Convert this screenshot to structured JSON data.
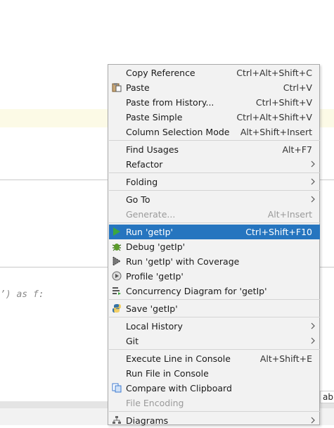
{
  "editor": {
    "code_fragment": "’) as f:",
    "right_fragment": "abl"
  },
  "menu": {
    "items": [
      {
        "id": "copy-reference",
        "label": "Copy Reference",
        "shortcut": "Ctrl+Alt+Shift+C"
      },
      {
        "id": "paste",
        "label": "Paste",
        "shortcut": "Ctrl+V"
      },
      {
        "id": "paste-from-history",
        "label": "Paste from History...",
        "shortcut": "Ctrl+Shift+V"
      },
      {
        "id": "paste-simple",
        "label": "Paste Simple",
        "shortcut": "Ctrl+Alt+Shift+V"
      },
      {
        "id": "column-selection-mode",
        "label": "Column Selection Mode",
        "shortcut": "Alt+Shift+Insert"
      },
      {
        "id": "find-usages",
        "label": "Find Usages",
        "shortcut": "Alt+F7"
      },
      {
        "id": "refactor",
        "label": "Refactor",
        "shortcut": ""
      },
      {
        "id": "folding",
        "label": "Folding",
        "shortcut": ""
      },
      {
        "id": "go-to",
        "label": "Go To",
        "shortcut": ""
      },
      {
        "id": "generate",
        "label": "Generate...",
        "shortcut": "Alt+Insert"
      },
      {
        "id": "run",
        "label": "Run 'getIp'",
        "shortcut": "Ctrl+Shift+F10"
      },
      {
        "id": "debug",
        "label": "Debug 'getIp'",
        "shortcut": ""
      },
      {
        "id": "run-coverage",
        "label": "Run 'getIp' with Coverage",
        "shortcut": ""
      },
      {
        "id": "profile",
        "label": "Profile 'getIp'",
        "shortcut": ""
      },
      {
        "id": "concurrency",
        "label": "Concurrency Diagram for 'getIp'",
        "shortcut": ""
      },
      {
        "id": "save",
        "label": "Save 'getIp'",
        "shortcut": ""
      },
      {
        "id": "local-history",
        "label": "Local History",
        "shortcut": ""
      },
      {
        "id": "git",
        "label": "Git",
        "shortcut": ""
      },
      {
        "id": "execute-line",
        "label": "Execute Line in Console",
        "shortcut": "Alt+Shift+E"
      },
      {
        "id": "run-file-console",
        "label": "Run File in Console",
        "shortcut": ""
      },
      {
        "id": "compare-clipboard",
        "label": "Compare with Clipboard",
        "shortcut": ""
      },
      {
        "id": "file-encoding",
        "label": "File Encoding",
        "shortcut": ""
      },
      {
        "id": "diagrams",
        "label": "Diagrams",
        "shortcut": ""
      }
    ]
  },
  "colors": {
    "selection": "#2675bf",
    "menu_bg": "#f2f2f2",
    "run_icon": "#3ca83c"
  }
}
